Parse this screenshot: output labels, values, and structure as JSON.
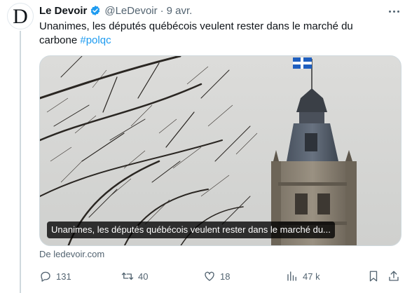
{
  "author": {
    "name": "Le Devoir",
    "handle": "@LeDevoir",
    "date": "9 avr.",
    "avatar_letter": "D"
  },
  "tweet": {
    "text": "Unanimes, les députés québécois veulent rester dans le marché du carbone ",
    "hashtag": "#polqc"
  },
  "media": {
    "caption": "Unanimes, les députés québécois veulent rester dans le marché du..."
  },
  "source": "De ledevoir.com",
  "actions": {
    "replies": "131",
    "retweets": "40",
    "likes": "18",
    "views": "47 k"
  },
  "colors": {
    "accent": "#1d9bf0",
    "muted": "#536471",
    "text": "#0f1419"
  },
  "icons": {
    "verified": "verified-badge-icon",
    "reply": "reply-icon",
    "retweet": "retweet-icon",
    "like": "heart-icon",
    "views": "bar-chart-icon",
    "bookmark": "bookmark-icon",
    "share": "share-icon",
    "more": "more-dots-icon"
  }
}
